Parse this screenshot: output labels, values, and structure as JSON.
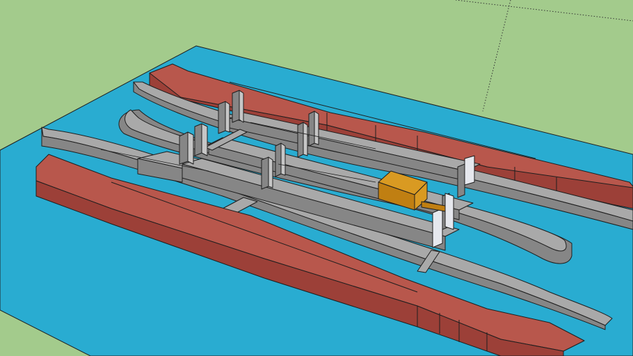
{
  "scene": {
    "colors": {
      "ground": "#a3cb8c",
      "water": "#29acd1",
      "pontoon_top": "#b8574c",
      "pontoon_side": "#9c4038",
      "frame_top": "#a9a9a9",
      "frame_side": "#868686",
      "post_face": "#c6c6c6",
      "post_light": "#e6e8ee",
      "box_top": "#d99a22",
      "box_side": "#c07f12",
      "edge": "#1e1e1e"
    }
  }
}
